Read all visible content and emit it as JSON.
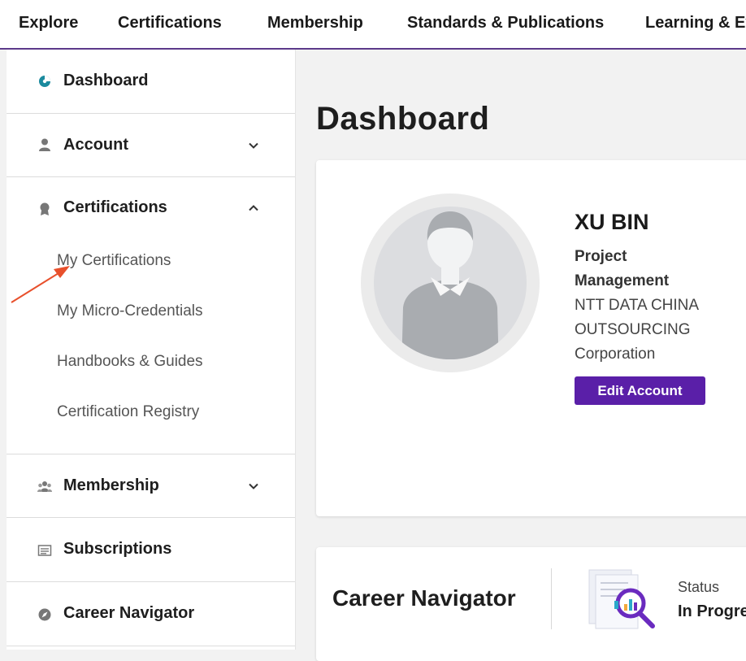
{
  "topnav": {
    "items": [
      "Explore",
      "Certifications",
      "Membership",
      "Standards & Publications",
      "Learning & Ev"
    ]
  },
  "sidebar": {
    "dashboard": {
      "label": "Dashboard",
      "icon": "dashboard-icon"
    },
    "account": {
      "label": "Account",
      "icon": "person-icon"
    },
    "certifications": {
      "label": "Certifications",
      "icon": "award-icon",
      "subitems": [
        "My Certifications",
        "My Micro-Credentials",
        "Handbooks & Guides",
        "Certification Registry"
      ]
    },
    "membership": {
      "label": "Membership",
      "icon": "group-icon"
    },
    "subscriptions": {
      "label": "Subscriptions",
      "icon": "newspaper-icon"
    },
    "career_navigator": {
      "label": "Career Navigator",
      "icon": "compass-icon"
    }
  },
  "main": {
    "title": "Dashboard",
    "profile": {
      "name": "XU BIN",
      "role": "Project Management",
      "organization": "NTT DATA CHINA OUTSOURCING Corporation",
      "edit_button": "Edit Account"
    },
    "career": {
      "title": "Career Navigator",
      "status_label": "Status",
      "status_value": "In Progre"
    }
  },
  "colors": {
    "accent": "#5a1fa8",
    "nav_border": "#5c3a8a",
    "annotation_arrow": "#e8502c",
    "dashboard_icon": "#1b8a9e"
  }
}
